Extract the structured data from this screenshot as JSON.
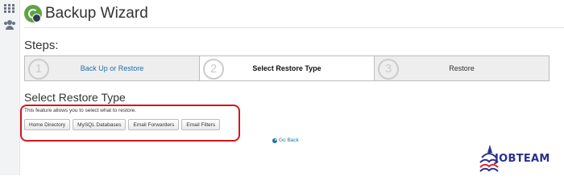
{
  "header": {
    "title": "Backup Wizard"
  },
  "steps": {
    "heading": "Steps:",
    "items": [
      {
        "number": "1",
        "label": "Back Up or Restore"
      },
      {
        "number": "2",
        "label": "Select Restore Type"
      },
      {
        "number": "3",
        "label": "Restore"
      }
    ]
  },
  "section": {
    "heading": "Select Restore Type",
    "description": "This feature allows you to select what to restore.",
    "buttons": [
      "Home Directory",
      "MySQL Databases",
      "Email Forwarders",
      "Email Filters"
    ]
  },
  "go_back": "Go Back",
  "watermark": {
    "text": "JOBTEAM"
  },
  "colors": {
    "link": "#1f6fa8",
    "highlight": "#d0171f",
    "brand_icon": "#5ea341",
    "watermark": "#2a2f8f"
  }
}
